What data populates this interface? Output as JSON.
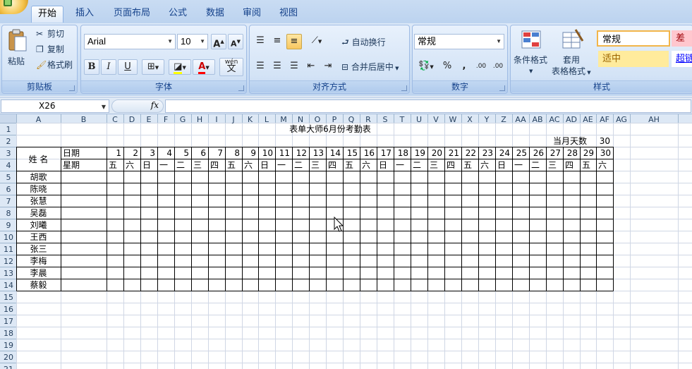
{
  "tabs": [
    "开始",
    "插入",
    "页面布局",
    "公式",
    "数据",
    "审阅",
    "视图"
  ],
  "clipboard": {
    "paste": "粘贴",
    "cut": "剪切",
    "copy": "复制",
    "format_painter": "格式刷",
    "group": "剪贴板"
  },
  "font": {
    "name": "Arial",
    "size": "10",
    "grow": "A",
    "shrink": "A",
    "bold": "B",
    "italic": "I",
    "underline": "U",
    "wen": "wén",
    "wen_char": "文",
    "group": "字体"
  },
  "alignment": {
    "wrap": "自动换行",
    "merge": "合并后居中",
    "group": "对齐方式"
  },
  "number": {
    "format": "常规",
    "percent": "%",
    "comma": ",",
    "inc": ".00",
    "dec": ".00",
    "group": "数字"
  },
  "styles": {
    "cond_format": "条件格式",
    "table_format_1": "套用",
    "table_format_2": "表格格式",
    "normal": "常规",
    "bad": "差",
    "neutral": "适中",
    "hyperlink": "超链",
    "group": "样式"
  },
  "namebox": "X26",
  "fx": "fx",
  "col_headers": [
    "A",
    "B",
    "C",
    "D",
    "E",
    "F",
    "G",
    "H",
    "I",
    "J",
    "K",
    "L",
    "M",
    "N",
    "O",
    "P",
    "Q",
    "R",
    "S",
    "T",
    "U",
    "V",
    "W",
    "X",
    "Y",
    "Z",
    "AA",
    "AB",
    "AC",
    "AD",
    "AE",
    "AF",
    "AG",
    "AH"
  ],
  "row_headers": [
    "1",
    "2",
    "3",
    "4",
    "5",
    "6",
    "7",
    "8",
    "9",
    "10",
    "11",
    "12",
    "13",
    "14",
    "15",
    "16",
    "17",
    "18",
    "19",
    "20",
    "21"
  ],
  "sheet": {
    "title": "表单大师6月份考勤表",
    "month_days_label": "当月天数",
    "month_days_value": "30",
    "name_header": "姓 名",
    "date_label": "日期",
    "week_label": "星期",
    "days": [
      "1",
      "2",
      "3",
      "4",
      "5",
      "6",
      "7",
      "8",
      "9",
      "10",
      "11",
      "12",
      "13",
      "14",
      "15",
      "16",
      "17",
      "18",
      "19",
      "20",
      "21",
      "22",
      "23",
      "24",
      "25",
      "26",
      "27",
      "28",
      "29",
      "30"
    ],
    "weekdays": [
      "五",
      "六",
      "日",
      "一",
      "二",
      "三",
      "四",
      "五",
      "六",
      "日",
      "一",
      "二",
      "三",
      "四",
      "五",
      "六",
      "日",
      "一",
      "二",
      "三",
      "四",
      "五",
      "六",
      "日",
      "一",
      "二",
      "三",
      "四",
      "五",
      "六"
    ],
    "names": [
      "胡歌",
      "陈晓",
      "张慧",
      "吴磊",
      "刘曦",
      "王西",
      "张三",
      "李梅",
      "李晨",
      "蔡毅"
    ]
  }
}
